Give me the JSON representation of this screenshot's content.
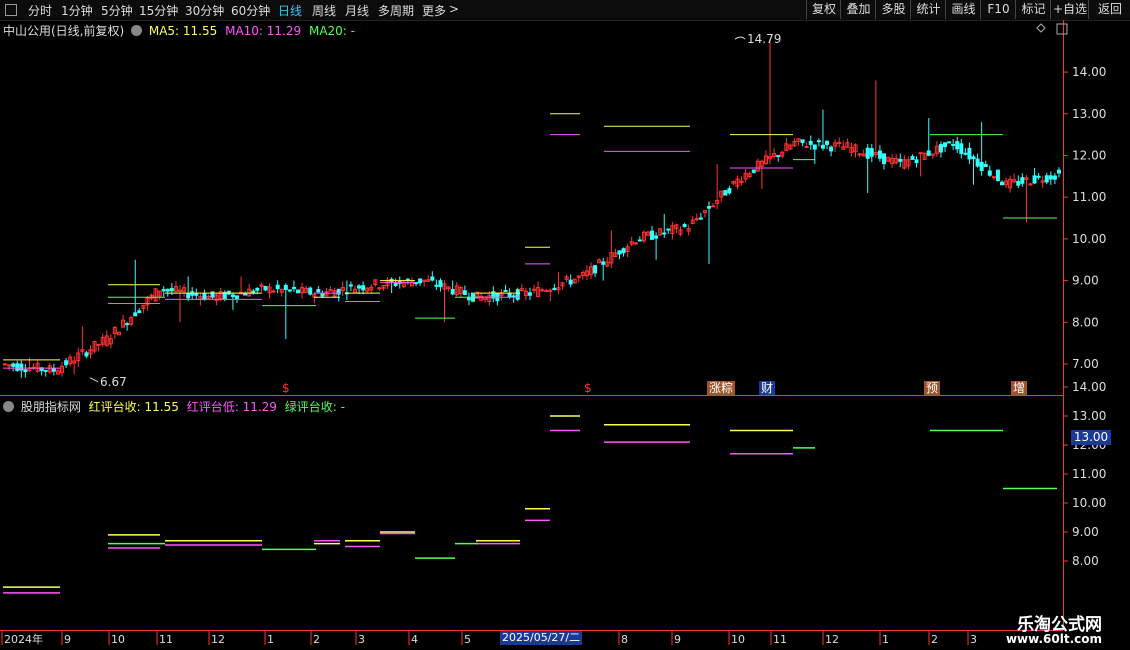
{
  "toolbar": {
    "periods": [
      "分时",
      "1分钟",
      "5分钟",
      "15分钟",
      "30分钟",
      "60分钟",
      "日线",
      "周线",
      "月线",
      "多周期",
      "更多"
    ],
    "active_period": "日线",
    "more_arrow": ">",
    "buttons": [
      "复权",
      "叠加",
      "多股",
      "统计",
      "画线",
      "F10",
      "标记",
      "+自选",
      "返回"
    ]
  },
  "main_panel": {
    "stock_title": "中山公用(日线,前复权)",
    "ma5_label": "MA5: 11.55",
    "ma10_label": "MA10: 11.29",
    "ma20_label": "MA20: -",
    "colors": {
      "ma5": "#ffff55",
      "ma10": "#ff55ff",
      "ma20": "#55ff55",
      "up": "#ff3333",
      "down": "#33ffff",
      "axis": "#ff3333"
    },
    "high_label": "14.79",
    "low_label": "6.67",
    "event_tags": [
      {
        "text": "$",
        "color": "#ff3333"
      },
      {
        "text": "$",
        "color": "#ff3333"
      },
      {
        "text": "涨粽",
        "color": "#ffffff",
        "bg": "#a0522d"
      },
      {
        "text": "财",
        "color": "#ffffff",
        "bg": "#1a3a9a"
      },
      {
        "text": "预",
        "color": "#ffffff",
        "bg": "#a0522d"
      },
      {
        "text": "增",
        "color": "#ffffff",
        "bg": "#a0522d"
      }
    ]
  },
  "indicator_panel": {
    "title": "股朋指标网",
    "red_close_label": "红评台收: 11.55",
    "red_low_label": "红评台低: 11.29",
    "green_close_label": "绿评台收: -",
    "price_tag": "13.00"
  },
  "x_axis": {
    "labels": [
      "2024年",
      "9",
      "10",
      "11",
      "12",
      "1",
      "2",
      "3",
      "4",
      "5",
      "2025/05/27/二",
      "8",
      "9",
      "10",
      "11",
      "12",
      "1",
      "2",
      "3"
    ]
  },
  "watermark": {
    "line1": "乐淘公式网",
    "line2": "www.60lt.com"
  },
  "chart_data": [
    {
      "type": "candlestick",
      "title": "中山公用(日线,前复权)",
      "y_ticks_main": [
        7.0,
        8.0,
        9.0,
        10.0,
        11.0,
        12.0,
        13.0,
        14.0
      ],
      "ylim": [
        6.4,
        15.1
      ],
      "grid": false,
      "annotations": [
        {
          "text": "14.79",
          "type": "max"
        },
        {
          "text": "6.67",
          "type": "min"
        }
      ],
      "segments": [
        {
          "period": "2024-08",
          "open": 7.0,
          "high": 7.15,
          "low": 6.67,
          "close": 6.85
        },
        {
          "period": "2024-09",
          "open": 6.85,
          "high": 7.9,
          "low": 6.75,
          "close": 7.6
        },
        {
          "period": "2024-10",
          "open": 7.6,
          "high": 9.5,
          "low": 7.8,
          "close": 8.8
        },
        {
          "period": "2024-11",
          "open": 8.8,
          "high": 9.1,
          "low": 8.0,
          "close": 8.6
        },
        {
          "period": "2024-12",
          "open": 8.6,
          "high": 9.1,
          "low": 8.3,
          "close": 8.8
        },
        {
          "period": "2025-01",
          "open": 8.8,
          "high": 9.0,
          "low": 7.6,
          "close": 8.7
        },
        {
          "period": "2025-02",
          "open": 8.7,
          "high": 9.0,
          "low": 8.5,
          "close": 8.9
        },
        {
          "period": "2025-03",
          "open": 8.9,
          "high": 9.1,
          "low": 8.7,
          "close": 9.0
        },
        {
          "period": "2025-04",
          "open": 9.0,
          "high": 9.0,
          "low": 8.0,
          "close": 8.6
        },
        {
          "period": "2025-05",
          "open": 8.6,
          "high": 8.9,
          "low": 8.4,
          "close": 8.7
        },
        {
          "period": "2025-06",
          "open": 8.7,
          "high": 9.2,
          "low": 8.5,
          "close": 9.1
        },
        {
          "period": "2025-07",
          "open": 9.1,
          "high": 10.2,
          "low": 9.0,
          "close": 10.0
        },
        {
          "period": "2025-08",
          "open": 10.0,
          "high": 10.6,
          "low": 9.5,
          "close": 10.3
        },
        {
          "period": "2025-09",
          "open": 10.3,
          "high": 11.8,
          "low": 9.4,
          "close": 11.5
        },
        {
          "period": "2025-10",
          "open": 11.5,
          "high": 14.79,
          "low": 11.2,
          "close": 12.3
        },
        {
          "period": "2025-11",
          "open": 12.3,
          "high": 13.1,
          "low": 11.8,
          "close": 12.2
        },
        {
          "period": "2025-12",
          "open": 12.2,
          "high": 13.8,
          "low": 11.1,
          "close": 11.8
        },
        {
          "period": "2026-01",
          "open": 11.8,
          "high": 12.9,
          "low": 11.5,
          "close": 12.3
        },
        {
          "period": "2026-02",
          "open": 12.3,
          "high": 12.8,
          "low": 11.3,
          "close": 11.3
        },
        {
          "period": "2026-03",
          "open": 11.3,
          "high": 11.7,
          "low": 10.4,
          "close": 11.55
        }
      ]
    },
    {
      "type": "line",
      "title": "股朋指标网",
      "y_ticks": [
        8.0,
        9.0,
        10.0,
        11.0,
        12.0,
        13.0,
        14.0
      ],
      "ylim": [
        7.1,
        14.6
      ],
      "series": [
        {
          "name": "红评台收",
          "color": "#ffff55",
          "values": [
            7.1,
            8.9,
            8.7,
            8.6,
            8.7,
            9.0,
            8.7,
            9.8,
            13.0,
            12.7,
            12.5
          ]
        },
        {
          "name": "红评台低",
          "color": "#ff55ff",
          "values": [
            6.9,
            8.45,
            8.55,
            8.7,
            8.5,
            8.95,
            8.6,
            9.4,
            12.5,
            12.1,
            11.7
          ]
        },
        {
          "name": "绿评台收",
          "color": "#55ff55",
          "values": [
            8.6,
            8.4,
            8.1,
            8.6,
            11.9,
            12.5,
            10.5
          ]
        }
      ]
    }
  ]
}
